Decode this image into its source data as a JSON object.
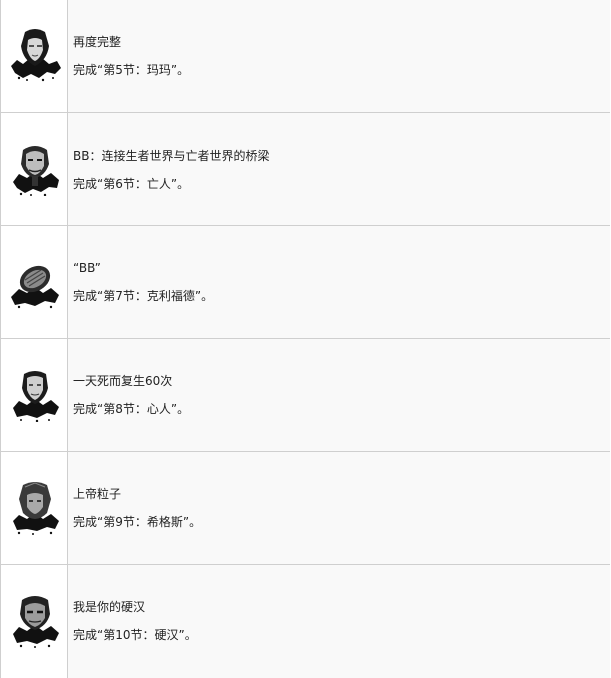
{
  "trophies": [
    {
      "title": "再度完整",
      "desc": "完成“第5节：玛玛”。",
      "icon": "mama-portrait-icon"
    },
    {
      "title": "BB：连接生者世界与亡者世界的桥梁",
      "desc": "完成“第6节：亡人”。",
      "icon": "deadman-portrait-icon"
    },
    {
      "title": "“BB”",
      "desc": "完成“第7节：克利福德”。",
      "icon": "bb-pod-icon"
    },
    {
      "title": "一天死而复生60次",
      "desc": "完成“第8节：心人”。",
      "icon": "heartman-portrait-icon"
    },
    {
      "title": "上帝粒子",
      "desc": "完成“第9节：希格斯”。",
      "icon": "higgs-portrait-icon"
    },
    {
      "title": "我是你的硬汉",
      "desc": "完成“第10节：硬汉”。",
      "icon": "die-hardman-portrait-icon"
    }
  ]
}
